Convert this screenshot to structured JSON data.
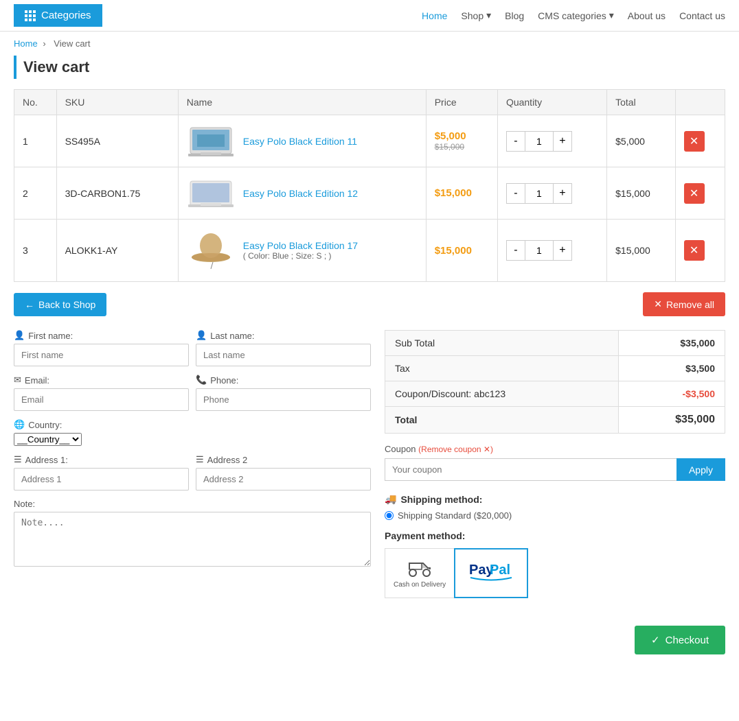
{
  "header": {
    "categories_label": "Categories",
    "nav": {
      "home": "Home",
      "shop": "Shop",
      "blog": "Blog",
      "cms_categories": "CMS categories",
      "about_us": "About us",
      "contact_us": "Contact us"
    }
  },
  "breadcrumb": {
    "home": "Home",
    "current": "View cart"
  },
  "page_title": "View cart",
  "table": {
    "headers": [
      "No.",
      "SKU",
      "Name",
      "Price",
      "Quantity",
      "Total",
      ""
    ],
    "rows": [
      {
        "no": "1",
        "sku": "SS495A",
        "name": "Easy Polo Black Edition 11",
        "price_current": "$5,000",
        "price_old": "$15,000",
        "qty": "1",
        "total": "$5,000"
      },
      {
        "no": "2",
        "sku": "3D-CARBON1.75",
        "name": "Easy Polo Black Edition 12",
        "price_current": "$15,000",
        "price_old": "",
        "qty": "1",
        "total": "$15,000"
      },
      {
        "no": "3",
        "sku": "ALOKK1-AY",
        "name": "Easy Polo Black Edition 17",
        "name_sub": "( Color: Blue ; Size: S ; )",
        "price_current": "$15,000",
        "price_old": "",
        "qty": "1",
        "total": "$15,000"
      }
    ]
  },
  "actions": {
    "back_to_shop": "Back to Shop",
    "remove_all": "Remove all"
  },
  "form": {
    "first_name_label": "First name:",
    "first_name_placeholder": "First name",
    "last_name_label": "Last name:",
    "last_name_placeholder": "Last name",
    "email_label": "Email:",
    "email_placeholder": "Email",
    "phone_label": "Phone:",
    "phone_placeholder": "Phone",
    "country_label": "Country:",
    "country_placeholder": "__Country__",
    "address1_label": "Address 1:",
    "address1_placeholder": "Address 1",
    "address2_label": "Address 2",
    "address2_placeholder": "Address 2",
    "note_label": "Note:",
    "note_placeholder": "Note...."
  },
  "summary": {
    "subtotal_label": "Sub Total",
    "subtotal_value": "$35,000",
    "tax_label": "Tax",
    "tax_value": "$3,500",
    "coupon_label": "Coupon/Discount: abc123",
    "coupon_value": "-$3,500",
    "total_label": "Total",
    "total_value": "$35,000"
  },
  "coupon": {
    "label": "Coupon",
    "remove_text": "(Remove coupon ✕)",
    "placeholder": "Your coupon",
    "apply_btn": "Apply"
  },
  "shipping": {
    "title": "Shipping method:",
    "option": "Shipping Standard ($20,000)"
  },
  "payment": {
    "title": "Payment method:",
    "cash_label": "Cash on Delivery",
    "paypal_label": "PayPal"
  },
  "checkout": {
    "btn_label": "Checkout"
  }
}
